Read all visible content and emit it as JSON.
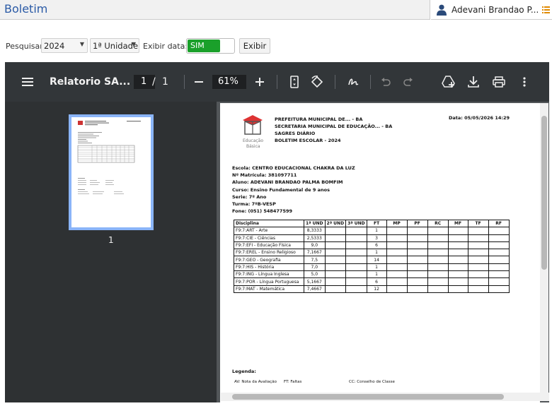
{
  "header": {
    "title": "Boletim",
    "user_name": "Adevani Brandao P..."
  },
  "filters": {
    "search_label": "Pesquisar:",
    "year_value": "2024",
    "unit_value": "1ª Unidade",
    "show_date_label": "Exibir data:",
    "toggle_label": "SIM",
    "submit_label": "Exibir"
  },
  "viewer": {
    "doc_title": "Relatorio SA...",
    "current_page": "1",
    "page_separator": "/",
    "total_pages": "1",
    "zoom": "61%",
    "thumbnail_number": "1"
  },
  "report": {
    "logo_text_1": "Educação",
    "logo_text_2": "Básica",
    "header_lines": [
      "PREFEITURA MUNICIPAL DE... - BA",
      "SECRETARIA MUNICIPAL DE EDUCAÇÃO... - BA",
      "SAGRES DIÁRIO",
      "BOLETIM ESCOLAR - 2024"
    ],
    "date_label": "Data:  05/05/2026 14:29",
    "info_lines": [
      "Escola: CENTRO EDUCACIONAL CHAKRA DA LUZ",
      "Nº Matrícula: 381097711",
      "Aluno: ADEVANI BRANDAO PALMA BOMFIM",
      "Curso: Ensino Fundamental de 9 anos",
      "Serie:  7º Ano",
      "Turma: 7ºB-VESP",
      "Fone: (051) 548477599"
    ],
    "table_headers": [
      "Disciplina",
      "1ª UND",
      "2ª UND",
      "3ª UND",
      "FT",
      "MP",
      "PF",
      "RC",
      "MF",
      "TF",
      "RF"
    ],
    "rows": [
      {
        "disciplina": "F9:7:ART - Arte",
        "und1": "8,3333",
        "ft": "1"
      },
      {
        "disciplina": "F9:7:CIE - Ciências",
        "und1": "2,5333",
        "ft": "3"
      },
      {
        "disciplina": "F9:7:EFI - Educação Física",
        "und1": "9,0",
        "ft": "6"
      },
      {
        "disciplina": "F9:7:EREL - Ensino Religioso",
        "und1": "7,1667",
        "ft": "1"
      },
      {
        "disciplina": "F9:7:GEO - Geografia",
        "und1": "7,5",
        "ft": "14"
      },
      {
        "disciplina": "F9:7:HIS - História",
        "und1": "7,0",
        "ft": "1"
      },
      {
        "disciplina": "F9:7:ING - Língua Inglesa",
        "und1": "5,0",
        "ft": "1"
      },
      {
        "disciplina": "F9:7:POR - Língua Portuguesa",
        "und1": "5,1667",
        "ft": "6"
      },
      {
        "disciplina": "F9:7:MAT - Matemática",
        "und1": "7,4667",
        "ft": "12"
      }
    ],
    "legend_title": "Legenda:",
    "legend_items": [
      "AV: Nota da Avaliação",
      "FT: Faltas",
      "CC: Conselho de Classe"
    ]
  }
}
